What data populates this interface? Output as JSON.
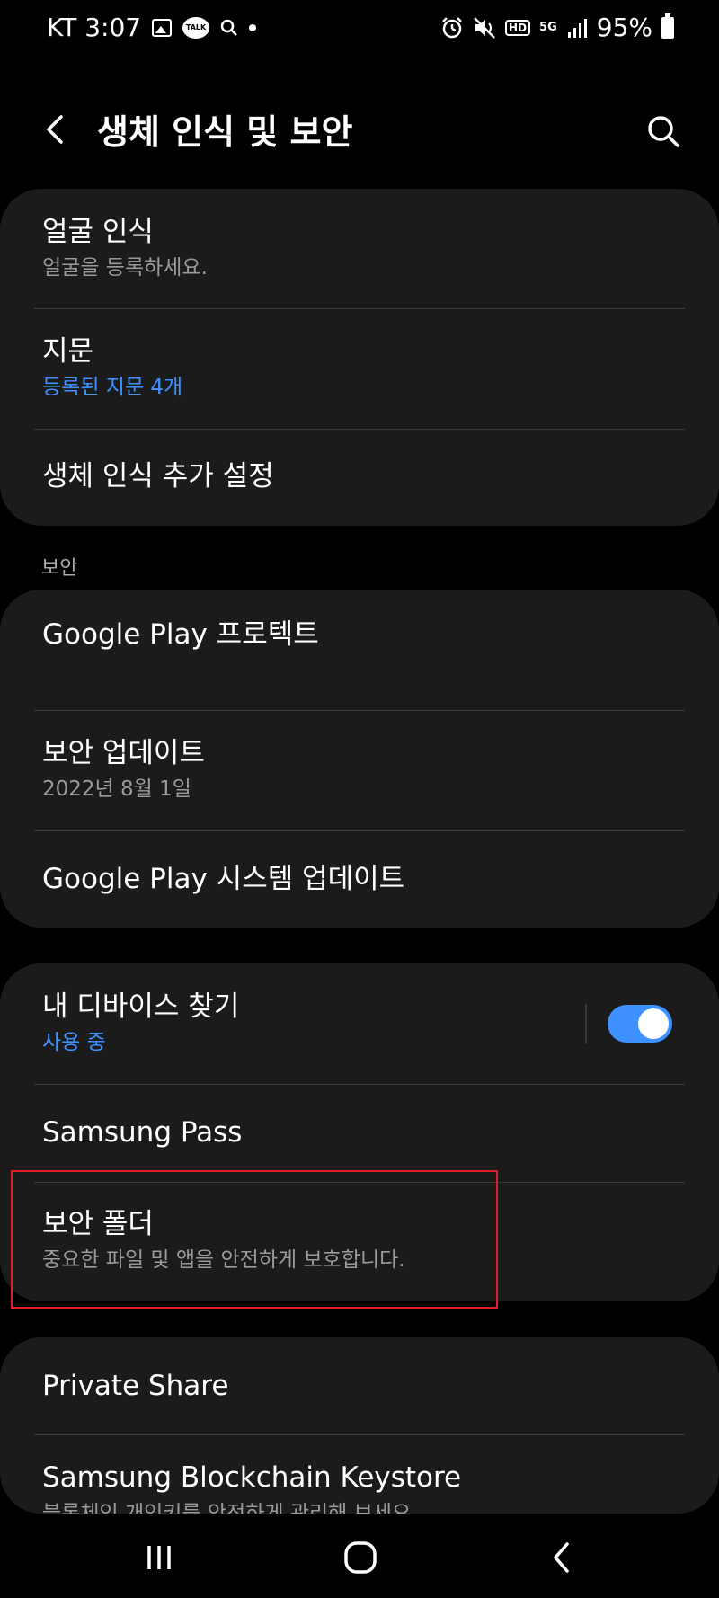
{
  "status_bar": {
    "carrier_time": "KT 3:07",
    "talk_badge": "TALK",
    "hd": "HD",
    "network": "5G",
    "battery_percent": "95%"
  },
  "header": {
    "title": "생체 인식 및 보안"
  },
  "biometrics": {
    "face": {
      "title": "얼굴 인식",
      "subtitle": "얼굴을 등록하세요."
    },
    "fingerprint": {
      "title": "지문",
      "subtitle": "등록된 지문 4개"
    },
    "extra": {
      "title": "생체 인식 추가 설정"
    }
  },
  "security": {
    "label": "보안",
    "play_protect": {
      "title": "Google Play 프로텍트"
    },
    "security_update": {
      "title": "보안 업데이트",
      "subtitle": "2022년 8월 1일"
    },
    "play_system_update": {
      "title": "Google Play 시스템 업데이트"
    }
  },
  "device": {
    "find_my": {
      "title": "내 디바이스 찾기",
      "subtitle": "사용 중",
      "enabled": true
    },
    "samsung_pass": {
      "title": "Samsung Pass"
    },
    "secure_folder": {
      "title": "보안 폴더",
      "subtitle": "중요한 파일 및 앱을 안전하게 보호합니다."
    }
  },
  "more": {
    "private_share": {
      "title": "Private Share"
    },
    "blockchain": {
      "title": "Samsung Blockchain Keystore",
      "subtitle": "블록체인 개인키를 안전하게 관리해 보세요."
    }
  },
  "colors": {
    "accent": "#3e91ff",
    "card": "#1b1b1b",
    "highlight": "#e01e25"
  },
  "icons": [
    "back-arrow-icon",
    "search-icon",
    "recents-icon",
    "home-icon",
    "nav-back-icon"
  ]
}
